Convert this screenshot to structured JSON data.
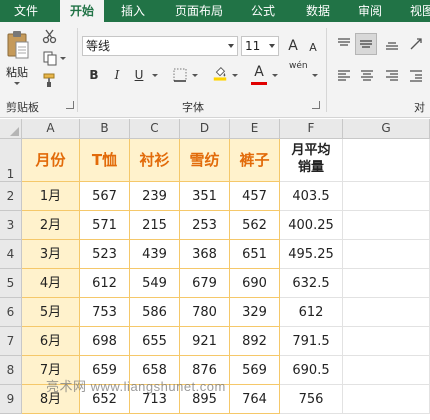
{
  "ribbon_tabs": [
    "文件",
    "开始",
    "插入",
    "页面布局",
    "公式",
    "数据",
    "审阅",
    "视图"
  ],
  "active_tab": "开始",
  "clipboard": {
    "paste_label": "粘贴",
    "group_label": "剪贴板"
  },
  "font_group": {
    "font_name": "等线",
    "font_size": "11",
    "bold": "B",
    "italic": "I",
    "underline": "U",
    "grow": "A",
    "shrink": "A",
    "wen": "wén",
    "font_color_letter": "A",
    "group_label": "字体"
  },
  "align_group": {
    "group_label_partial": "对"
  },
  "colors": {
    "excel_green": "#217346",
    "header_fill": "#fff2cc",
    "header_text": "#e26b0a",
    "highlight_yellow": "#ffd400",
    "font_red": "#e00000"
  },
  "columns": [
    "A",
    "B",
    "C",
    "D",
    "E",
    "F",
    "G"
  ],
  "rows": [
    "1",
    "2",
    "3",
    "4",
    "5",
    "6",
    "7",
    "8",
    "9"
  ],
  "table": {
    "headers": [
      "月份",
      "T恤",
      "衬衫",
      "雪纺",
      "裤子"
    ],
    "avg_header_line1": "月平均",
    "avg_header_line2": "销量",
    "data": [
      [
        "1月",
        "567",
        "239",
        "351",
        "457",
        "403.5"
      ],
      [
        "2月",
        "571",
        "215",
        "253",
        "562",
        "400.25"
      ],
      [
        "3月",
        "523",
        "439",
        "368",
        "651",
        "495.25"
      ],
      [
        "4月",
        "612",
        "549",
        "679",
        "690",
        "632.5"
      ],
      [
        "5月",
        "753",
        "586",
        "780",
        "329",
        "612"
      ],
      [
        "6月",
        "698",
        "655",
        "921",
        "892",
        "791.5"
      ],
      [
        "7月",
        "659",
        "658",
        "876",
        "569",
        "690.5"
      ],
      [
        "8月",
        "652",
        "713",
        "895",
        "764",
        "756"
      ]
    ]
  },
  "watermark": "亮术网 www.liangshunet.com"
}
